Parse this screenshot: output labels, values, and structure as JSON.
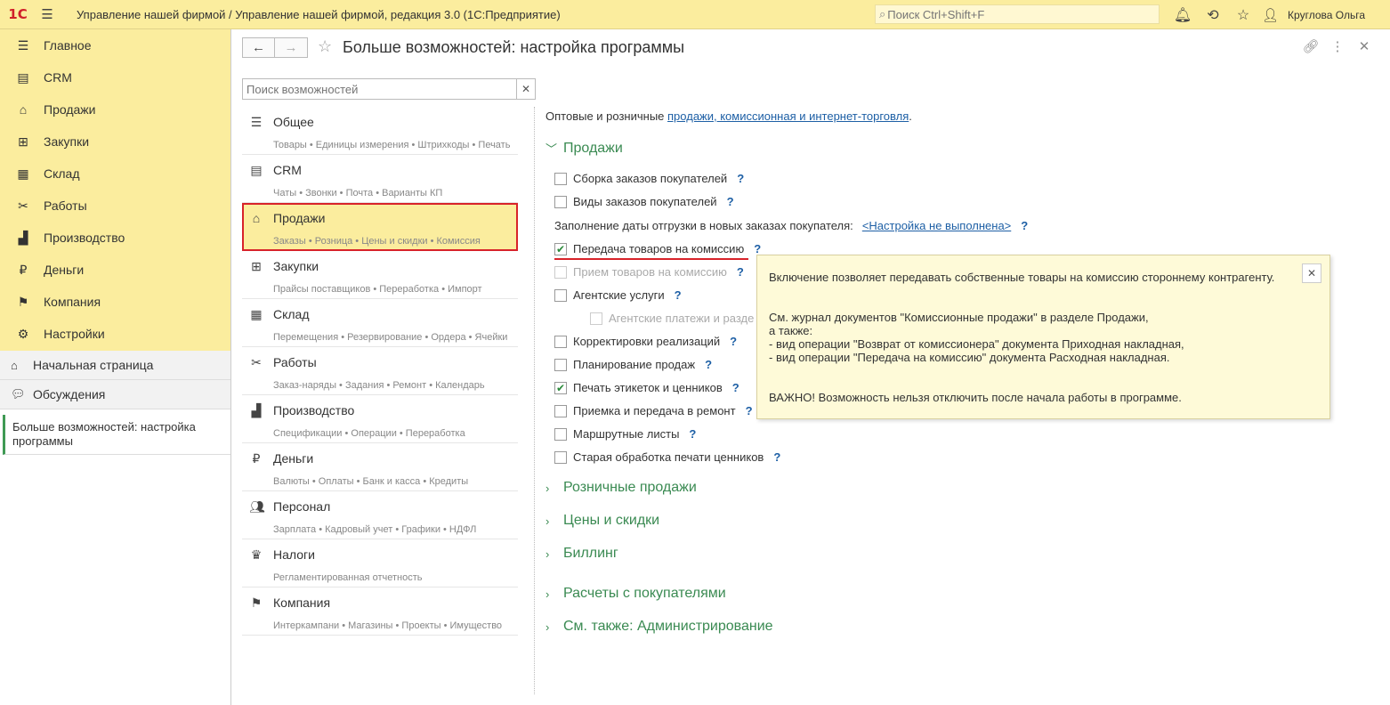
{
  "topbar": {
    "logo": "1С",
    "title": "Управление нашей фирмой / Управление нашей фирмой, редакция 3.0  (1С:Предприятие)",
    "search_placeholder": "Поиск Ctrl+Shift+F",
    "user": "Круглова Ольга"
  },
  "sidebar": {
    "sections": [
      {
        "label": "Главное",
        "icon": "menu-lines-icon"
      },
      {
        "label": "CRM",
        "icon": "crm-card-icon"
      },
      {
        "label": "Продажи",
        "icon": "basket-icon"
      },
      {
        "label": "Закупки",
        "icon": "cart-icon"
      },
      {
        "label": "Склад",
        "icon": "warehouse-grid-icon"
      },
      {
        "label": "Работы",
        "icon": "tools-icon"
      },
      {
        "label": "Производство",
        "icon": "factory-icon"
      },
      {
        "label": "Деньги",
        "icon": "ruble-coin-icon"
      },
      {
        "label": "Компания",
        "icon": "flag-icon"
      },
      {
        "label": "Настройки",
        "icon": "gear-icon"
      }
    ],
    "home": "Начальная страница",
    "discussions": "Обсуждения",
    "open_window": "Больше возможностей: настройка программы"
  },
  "main": {
    "title": "Больше возможностей: настройка программы",
    "search_placeholder": "Поиск возможностей",
    "features": [
      {
        "name": "Общее",
        "sub": "Товары • Единицы измерения • Штрихкоды • Печать",
        "icon": "menu-lines-icon"
      },
      {
        "name": "CRM",
        "sub": "Чаты • Звонки • Почта • Варианты КП",
        "icon": "crm-card-icon"
      },
      {
        "name": "Продажи",
        "sub": "Заказы • Розница • Цены и скидки • Комиссия",
        "icon": "basket-icon"
      },
      {
        "name": "Закупки",
        "sub": "Прайсы поставщиков • Переработка • Импорт",
        "icon": "cart-icon"
      },
      {
        "name": "Склад",
        "sub": "Перемещения • Резервирование • Ордера • Ячейки",
        "icon": "warehouse-grid-icon"
      },
      {
        "name": "Работы",
        "sub": "Заказ-наряды • Задания • Ремонт • Календарь",
        "icon": "tools-icon"
      },
      {
        "name": "Производство",
        "sub": "Спецификации • Операции • Переработка",
        "icon": "factory-icon"
      },
      {
        "name": "Деньги",
        "sub": "Валюты • Оплаты • Банк и касса • Кредиты",
        "icon": "ruble-coin-icon"
      },
      {
        "name": "Персонал",
        "sub": "Зарплата • Кадровый учет • Графики • НДФЛ",
        "icon": "people-icon"
      },
      {
        "name": "Налоги",
        "sub": "Регламентированная отчетность",
        "icon": "emblem-icon"
      },
      {
        "name": "Компания",
        "sub": "Интеркампани • Магазины • Проекты • Имущество",
        "icon": "flag-icon"
      }
    ],
    "intro_prefix": "Оптовые и розничные ",
    "intro_link": "продажи, комиссионная и интернет-торговля",
    "intro_suffix": ".",
    "group_sales": "Продажи",
    "options": {
      "o1": "Сборка заказов покупателей",
      "o2": "Виды заказов покупателей",
      "date_label": "Заполнение даты отгрузки в новых заказах покупателя:",
      "date_link": "<Настройка не выполнена>",
      "o3": "Передача товаров на комиссию",
      "o4": "Прием товаров на комиссию",
      "o5": "Агентские услуги",
      "o6": "Агентские платежи и разде",
      "o7": "Корректировки реализаций",
      "o8": "Планирование продаж",
      "o9": "Печать этикеток и ценников",
      "o10": "Приемка и передача в ремонт",
      "o11": "Маршрутные листы",
      "o12": "Старая обработка печати ценников"
    },
    "q": "?",
    "groups": [
      "Розничные продажи",
      "Цены и скидки",
      "Биллинг",
      "Расчеты с покупателями",
      "См. также: Администрирование"
    ]
  },
  "tooltip": {
    "line1": "Включение позволяет передавать собственные товары на комиссию стороннему контрагенту.",
    "line2": "См. журнал документов \"Комиссионные продажи\" в разделе Продажи,",
    "line3": "а также:",
    "line4": "- вид операции \"Возврат от комиссионера\" документа Приходная накладная,",
    "line5": "- вид операции \"Передача на комиссию\" документа Расходная накладная.",
    "line6": "ВАЖНО! Возможность нельзя отключить после начала работы в программе."
  }
}
